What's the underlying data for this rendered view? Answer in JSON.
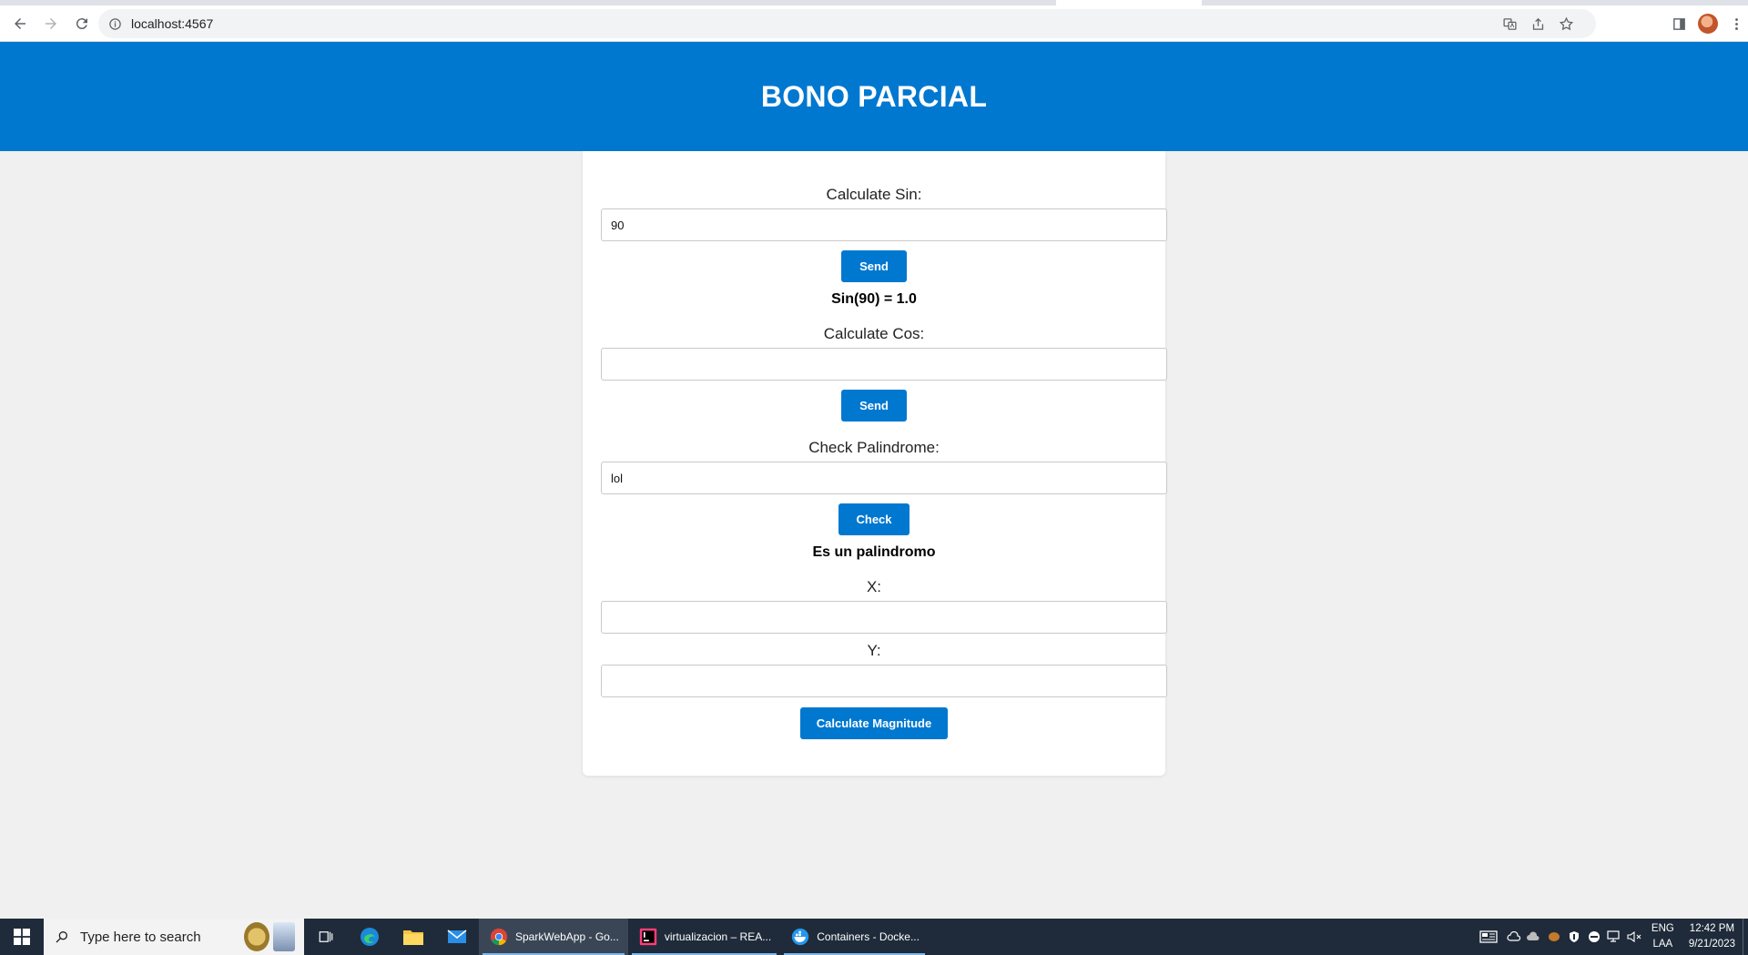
{
  "browser": {
    "url": "localhost:4567"
  },
  "page": {
    "title": "BONO PARCIAL",
    "sin": {
      "label": "Calculate Sin:",
      "value": "90",
      "button": "Send",
      "result": "Sin(90) = 1.0"
    },
    "cos": {
      "label": "Calculate Cos:",
      "value": "",
      "button": "Send"
    },
    "palindrome": {
      "label": "Check Palindrome:",
      "value": "lol",
      "button": "Check",
      "result": "Es un palindromo"
    },
    "magnitude": {
      "x_label": "X:",
      "x_value": "",
      "y_label": "Y:",
      "y_value": "",
      "button": "Calculate Magnitude"
    }
  },
  "taskbar": {
    "search_placeholder": "Type here to search",
    "apps": [
      {
        "label": "SparkWebApp - Go..."
      },
      {
        "label": "virtualizacion – REA..."
      },
      {
        "label": "Containers - Docke..."
      }
    ],
    "language": "ENG",
    "language_sub": "LAA",
    "time": "12:42 PM",
    "date": "9/21/2023"
  },
  "colors": {
    "brand": "#0078d0",
    "background": "#f0f0f0"
  }
}
